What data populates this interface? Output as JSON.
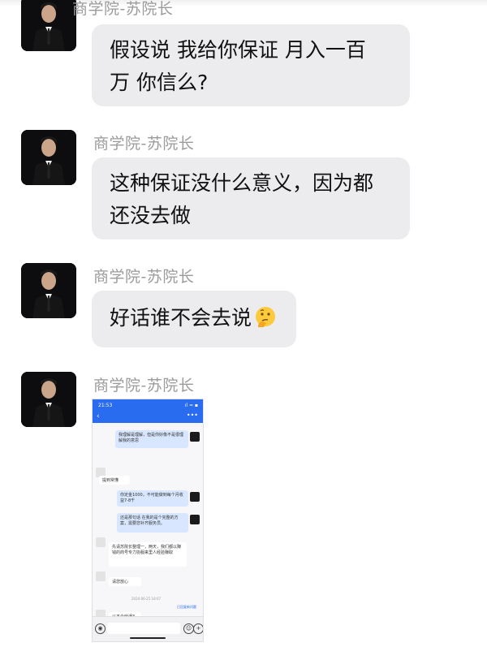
{
  "messages": [
    {
      "sender": "商学院-苏院长",
      "lines": [
        "假设说 我给你保证 月入一百",
        "万 你信么?"
      ]
    },
    {
      "sender": "商学院-苏院长",
      "lines": [
        "这种保证没什么意义，因为都",
        "还没去做"
      ]
    },
    {
      "sender": "商学院-苏院长",
      "lines": [
        "好话谁不会去说"
      ],
      "emoji": "thinking-face-emoji"
    },
    {
      "sender": "商学院-苏院长",
      "image": "chat-screenshot"
    }
  ],
  "screenshot": {
    "status_time": "21:53",
    "status_right": "ıl ≈ ▪",
    "back": "‹",
    "menu": "•••",
    "bubbles": [
      {
        "text": "我理解是理解，但是你好像不是很理解我的意思",
        "side": "right"
      },
      {
        "text": "提到常懂",
        "side": "left"
      },
      {
        "text": "你定金1000，不可能做到每个月收益7-8千",
        "side": "right"
      },
      {
        "text": "还是那句话 在我的是个完整的方案，需要您补齐服务员。",
        "side": "right"
      },
      {
        "text": "先请苏院长整理一，两天，我们都以赚钱的商号专力协服来里人经验赚取",
        "side": "left"
      },
      {
        "text": "请您放心",
        "side": "left"
      },
      {
        "text": "以不会延误3天",
        "side": "left"
      }
    ],
    "timestamp": "2024-06-25 18:07",
    "link_text": "已回复新问题"
  },
  "colors": {
    "bubble": "#ececee",
    "name": "#9b9b9b",
    "text": "#111111",
    "accent": "#2a6cf0"
  }
}
